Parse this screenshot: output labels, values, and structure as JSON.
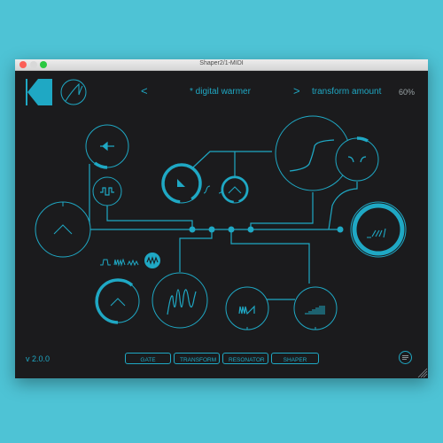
{
  "window": {
    "title": "Shaper2/1-MIDI"
  },
  "header": {
    "prev_label": "<",
    "next_label": ">",
    "preset_name": "* digital warmer",
    "param_name": "transform amount",
    "param_value": "60%"
  },
  "shape_selector": {
    "options": [
      "s-curve-sharp",
      "s-curve-dot",
      "s-curve-soft",
      "s-curve-medium",
      "linear"
    ],
    "selected_index": 0
  },
  "wave_selector": {
    "options": [
      "pulse",
      "noise",
      "saw-wave",
      "random-wave"
    ],
    "selected_index": 3
  },
  "footer": {
    "version": "v 2.0.0",
    "tabs": [
      "GATE",
      "TRANSFORM",
      "RESONATOR",
      "SHAPER"
    ]
  },
  "colors": {
    "accent": "#1fa8c4",
    "background": "#1b1b1d",
    "desktop": "#4ec3d5"
  },
  "knobs": {
    "input_trim": {
      "arc_fraction": 0.18
    },
    "gate_amount": {
      "arc_fraction": 0.9
    },
    "resonator_knob": {
      "arc_fraction": 0.55
    },
    "output_knob": {
      "arc_fraction": 1.0
    },
    "filter_knob": {
      "arc_fraction": 0.12
    }
  }
}
